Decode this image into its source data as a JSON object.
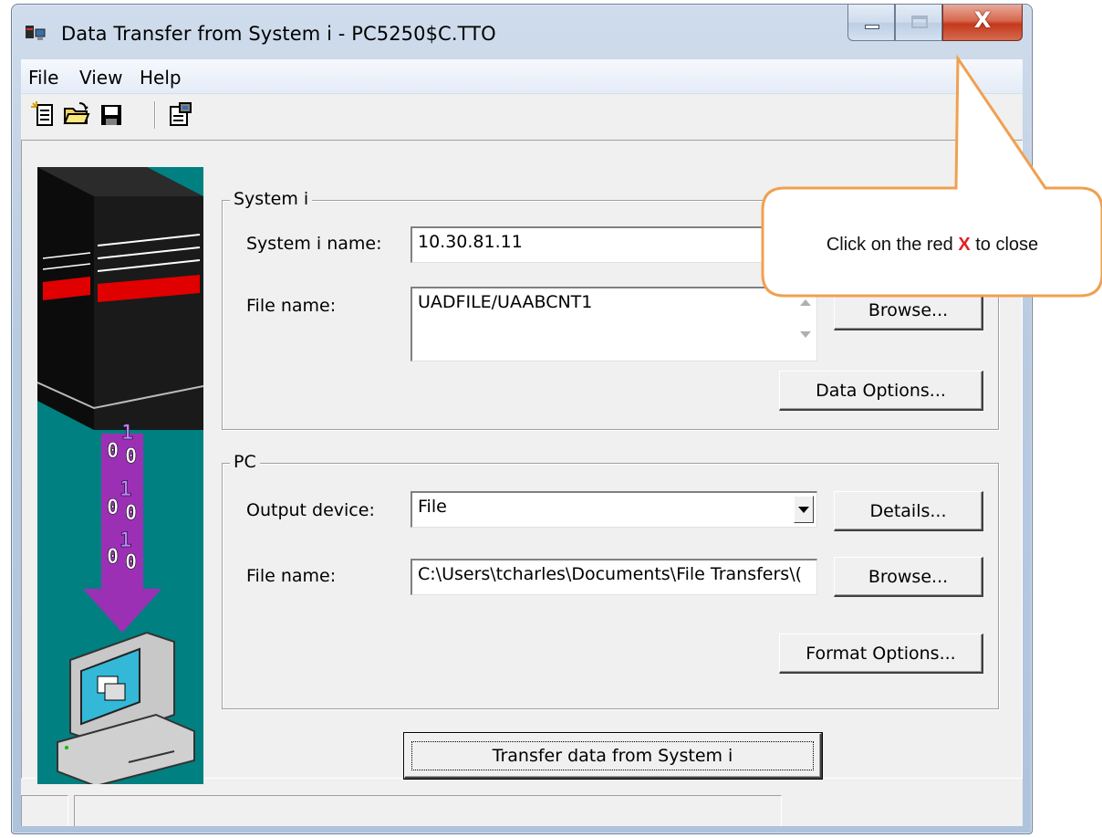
{
  "window": {
    "title": "Data Transfer from System i - PC5250$C.TTO",
    "close_glyph": "X"
  },
  "menu": {
    "file": "File",
    "view": "View",
    "help": "Help"
  },
  "toolbar": {
    "icons": [
      "new-file-icon",
      "open-folder-icon",
      "save-disk-icon",
      "properties-icon"
    ]
  },
  "system_group": {
    "title": "System i",
    "system_name_label": "System i name:",
    "system_name_value": "10.30.81.11",
    "file_name_label": "File name:",
    "file_name_value": "UADFILE/UAABCNT1",
    "browse_label": "Browse...",
    "data_options_label": "Data Options..."
  },
  "pc_group": {
    "title": "PC",
    "output_device_label": "Output device:",
    "output_device_value": "File",
    "details_label": "Details...",
    "file_name_label": "File name:",
    "file_name_value": "C:\\Users\\tcharles\\Documents\\File Transfers\\(",
    "browse_label": "Browse...",
    "format_options_label": "Format Options..."
  },
  "transfer_button": "Transfer data from System i",
  "callout": {
    "prefix": "Click on the red ",
    "highlight": "X",
    "suffix": " to close"
  },
  "colors": {
    "illustration_bg": "#008080",
    "callout_border": "#f0a050",
    "close_button": "#c4391b"
  }
}
